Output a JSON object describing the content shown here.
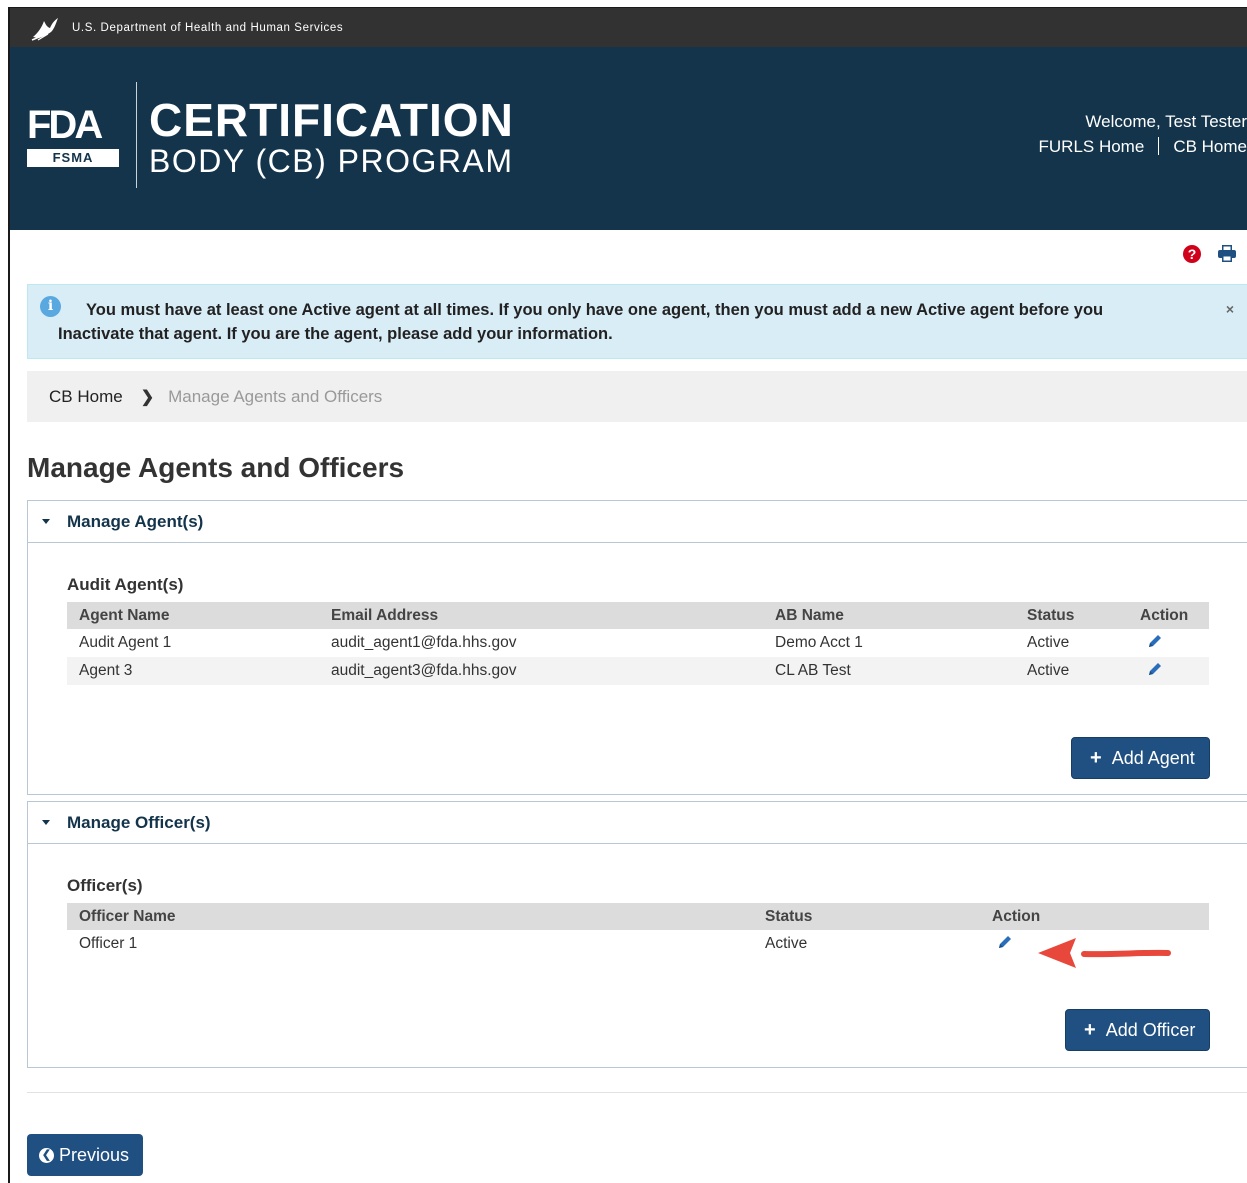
{
  "hhs_bar": {
    "text": "U.S. Department of Health and Human Services"
  },
  "masthead": {
    "logo_mark": "FDA",
    "logo_sub": "FSMA",
    "title_line1": "CERTIFICATION",
    "title_line2": "BODY (CB) PROGRAM",
    "welcome": "Welcome, Test Tester",
    "nav": {
      "furls_home": "FURLS Home",
      "cb_home": "CB Home"
    }
  },
  "utility_icons": [
    "help-icon",
    "print-icon"
  ],
  "alert": {
    "line1": "You must have at least one Active agent at all times. If you only have one agent, then you must add a new Active agent before you",
    "line2": "Inactivate that agent. If you are the agent, please add your information.",
    "close": "×"
  },
  "breadcrumb": {
    "home": "CB Home",
    "current": "Manage Agents and Officers"
  },
  "page_title": "Manage Agents and Officers",
  "agents_panel": {
    "heading": "Manage Agent(s)",
    "section": "Audit Agent(s)",
    "columns": [
      "Agent Name",
      "Email Address",
      "AB Name",
      "Status",
      "Action"
    ],
    "rows": [
      {
        "name": "Audit Agent 1",
        "email": "audit_agent1@fda.hhs.gov",
        "ab": "Demo Acct 1",
        "status": "Active"
      },
      {
        "name": "Agent 3",
        "email": "audit_agent3@fda.hhs.gov",
        "ab": "CL AB Test",
        "status": "Active"
      }
    ],
    "add_button": "Add Agent"
  },
  "officers_panel": {
    "heading": "Manage Officer(s)",
    "section": "Officer(s)",
    "columns": [
      "Officer Name",
      "Status",
      "Action"
    ],
    "rows": [
      {
        "name": "Officer 1",
        "status": "Active"
      }
    ],
    "add_button": "Add Officer"
  },
  "previous_button": "Previous",
  "colors": {
    "masthead": "#13344b",
    "hhs_bar": "#323232",
    "primary_button": "#205081",
    "alert_bg": "#d9edf7",
    "annotation_arrow": "#e8483b"
  }
}
